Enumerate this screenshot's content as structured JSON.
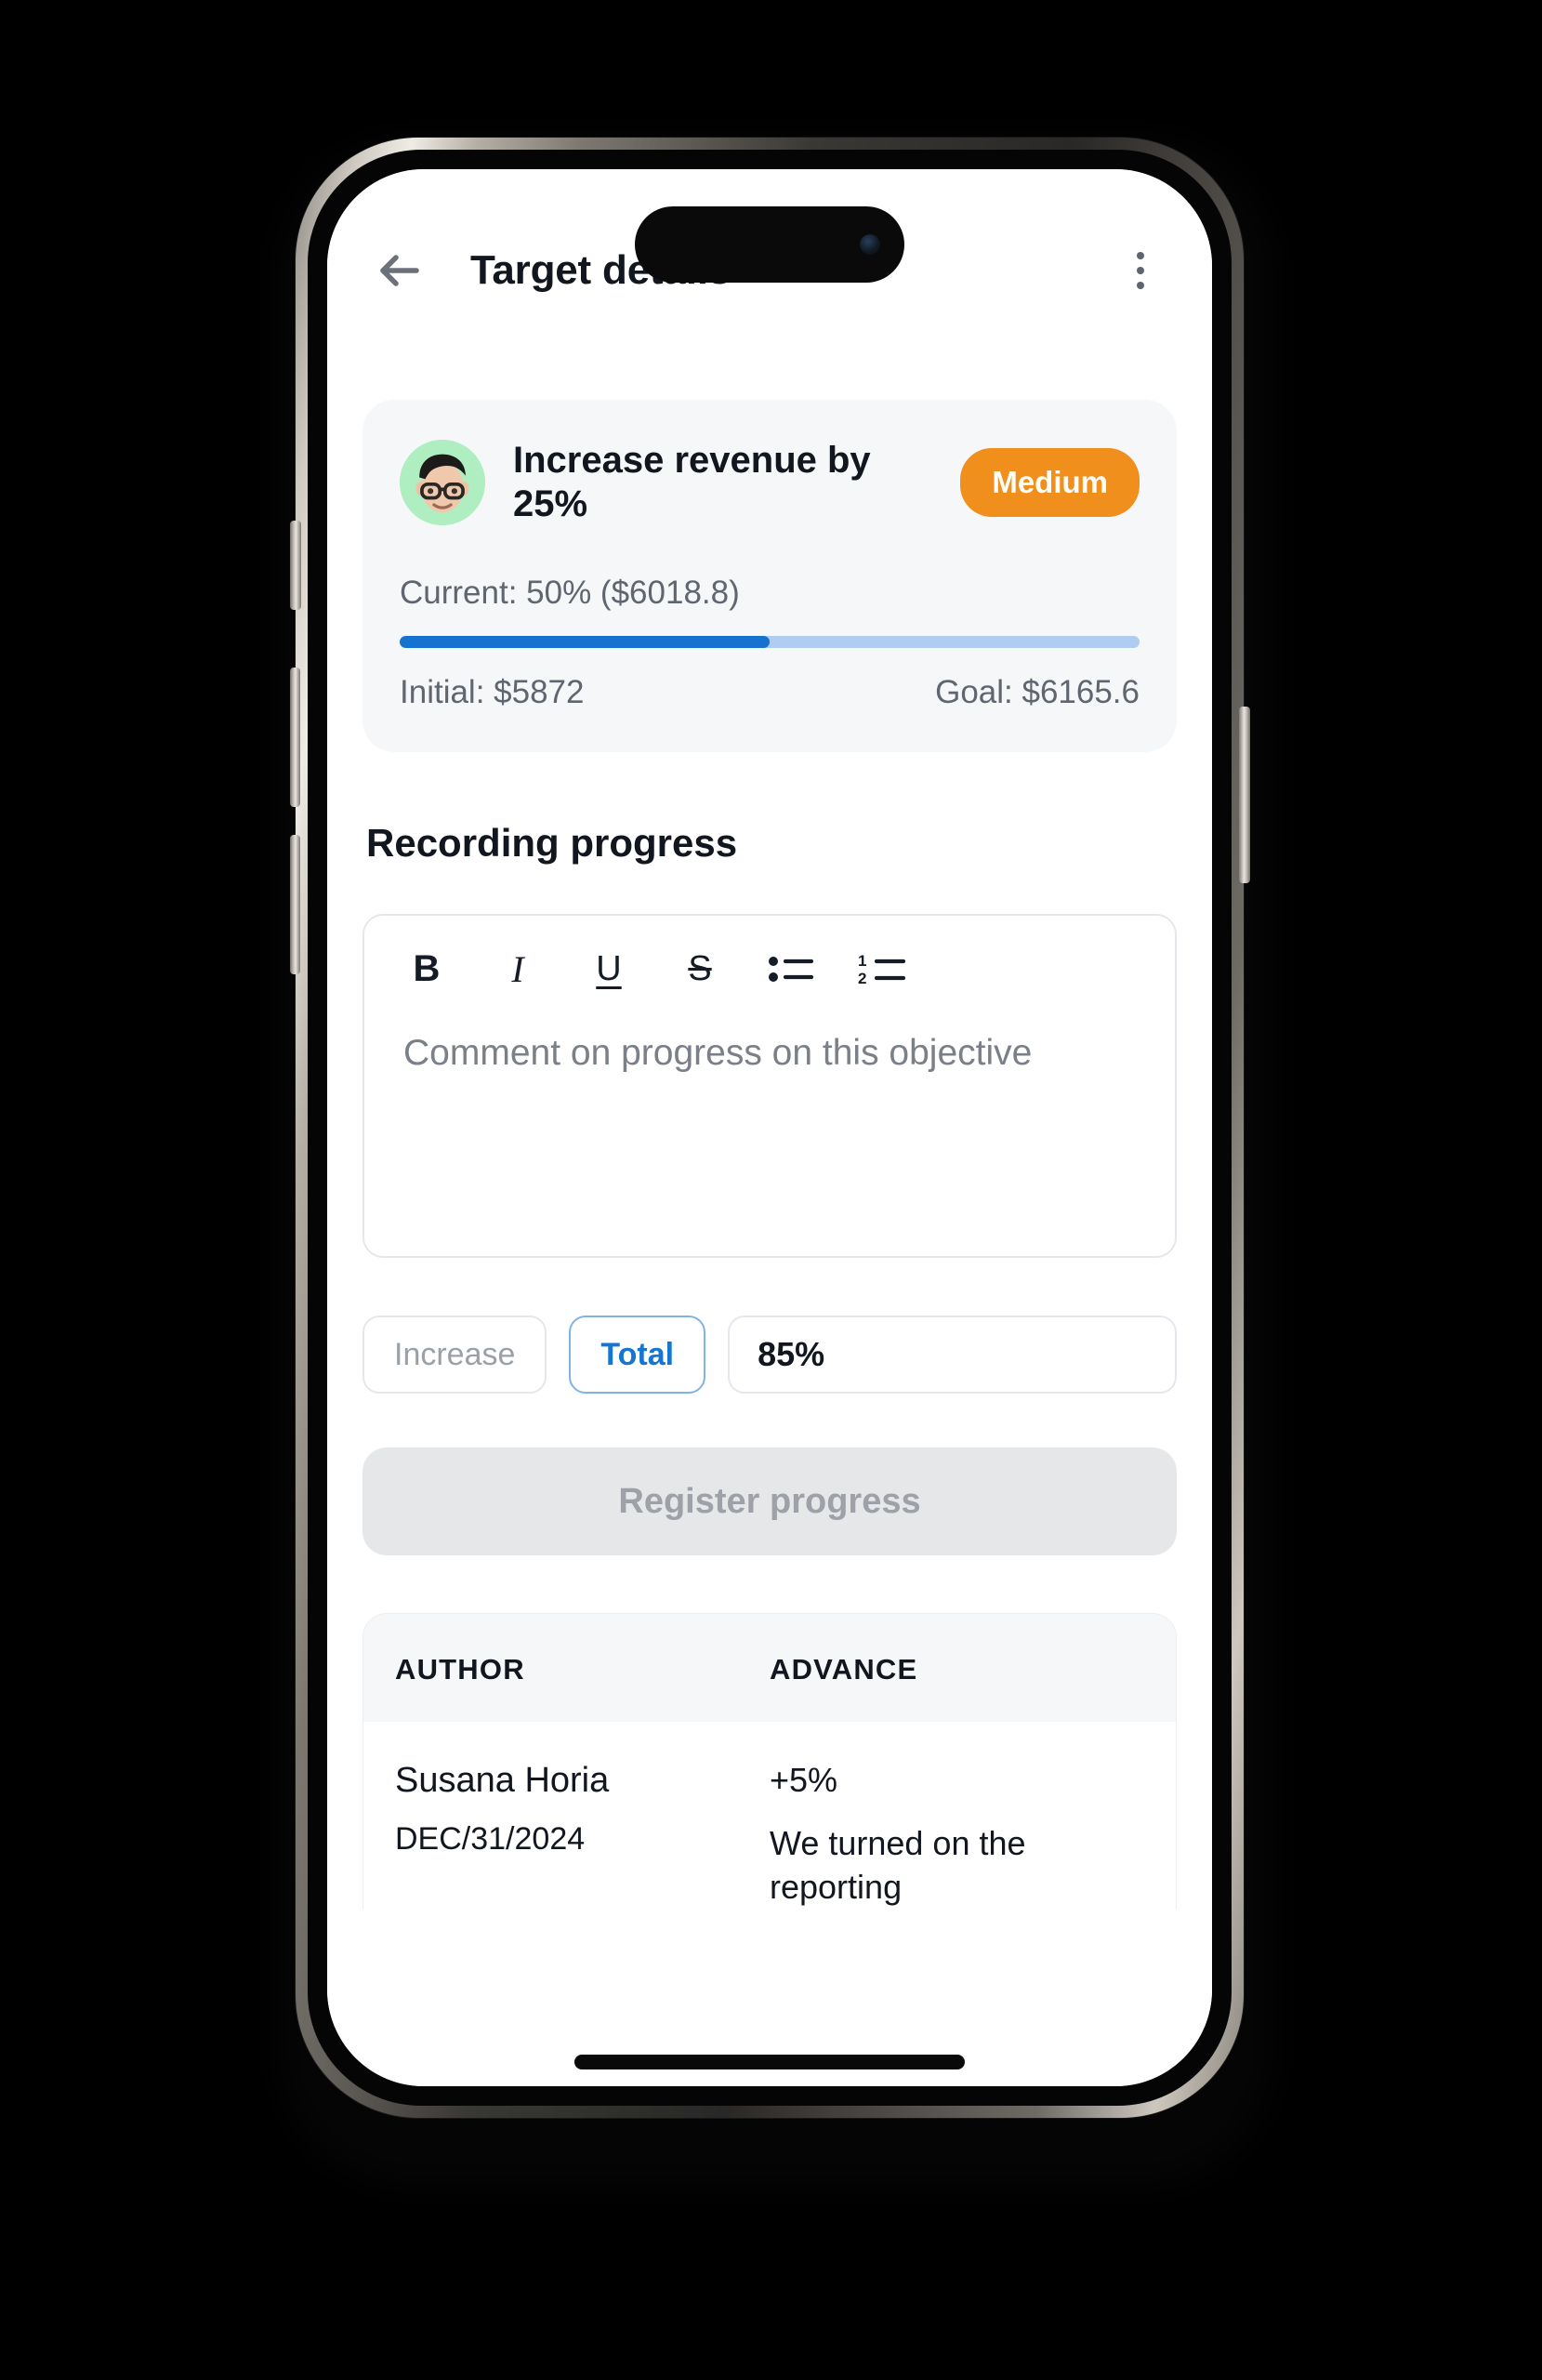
{
  "appbar": {
    "back_icon": "arrow-left-icon",
    "title": "Target details",
    "menu_icon": "kebab-menu-icon"
  },
  "target_card": {
    "avatar": "memoji-avatar",
    "goal_title": "Increase revenue by 25%",
    "priority_badge": "Medium",
    "priority_color": "#f18f1c",
    "current_line": "Current: 50% ($6018.8)",
    "progress_percent": 50,
    "progress_fill_color": "#1573cf",
    "progress_track_color": "#aecdf0",
    "initial_label": "Initial: $5872",
    "goal_label": "Goal: $6165.6"
  },
  "recording": {
    "section_title": "Recording progress",
    "toolbar": [
      {
        "name": "bold-icon",
        "glyph": "B"
      },
      {
        "name": "italic-icon",
        "glyph": "I"
      },
      {
        "name": "underline-icon",
        "glyph": "U"
      },
      {
        "name": "strikethrough-icon",
        "glyph": "S"
      },
      {
        "name": "bulleted-list-icon",
        "glyph": ""
      },
      {
        "name": "numbered-list-icon",
        "glyph": ""
      }
    ],
    "editor_placeholder": "Comment on progress on this objective"
  },
  "controls": {
    "increase_label": "Increase",
    "total_label": "Total",
    "total_selected": true,
    "value": "85%",
    "register_label": "Register progress",
    "register_enabled": false,
    "accent_color": "#1476d2"
  },
  "history": {
    "columns": [
      "AUTHOR",
      "ADVANCE"
    ],
    "rows": [
      {
        "author": "Susana Horia",
        "date": "DEC/31/2024",
        "advance": "+5%",
        "note": "We turned on the reporting"
      }
    ]
  }
}
